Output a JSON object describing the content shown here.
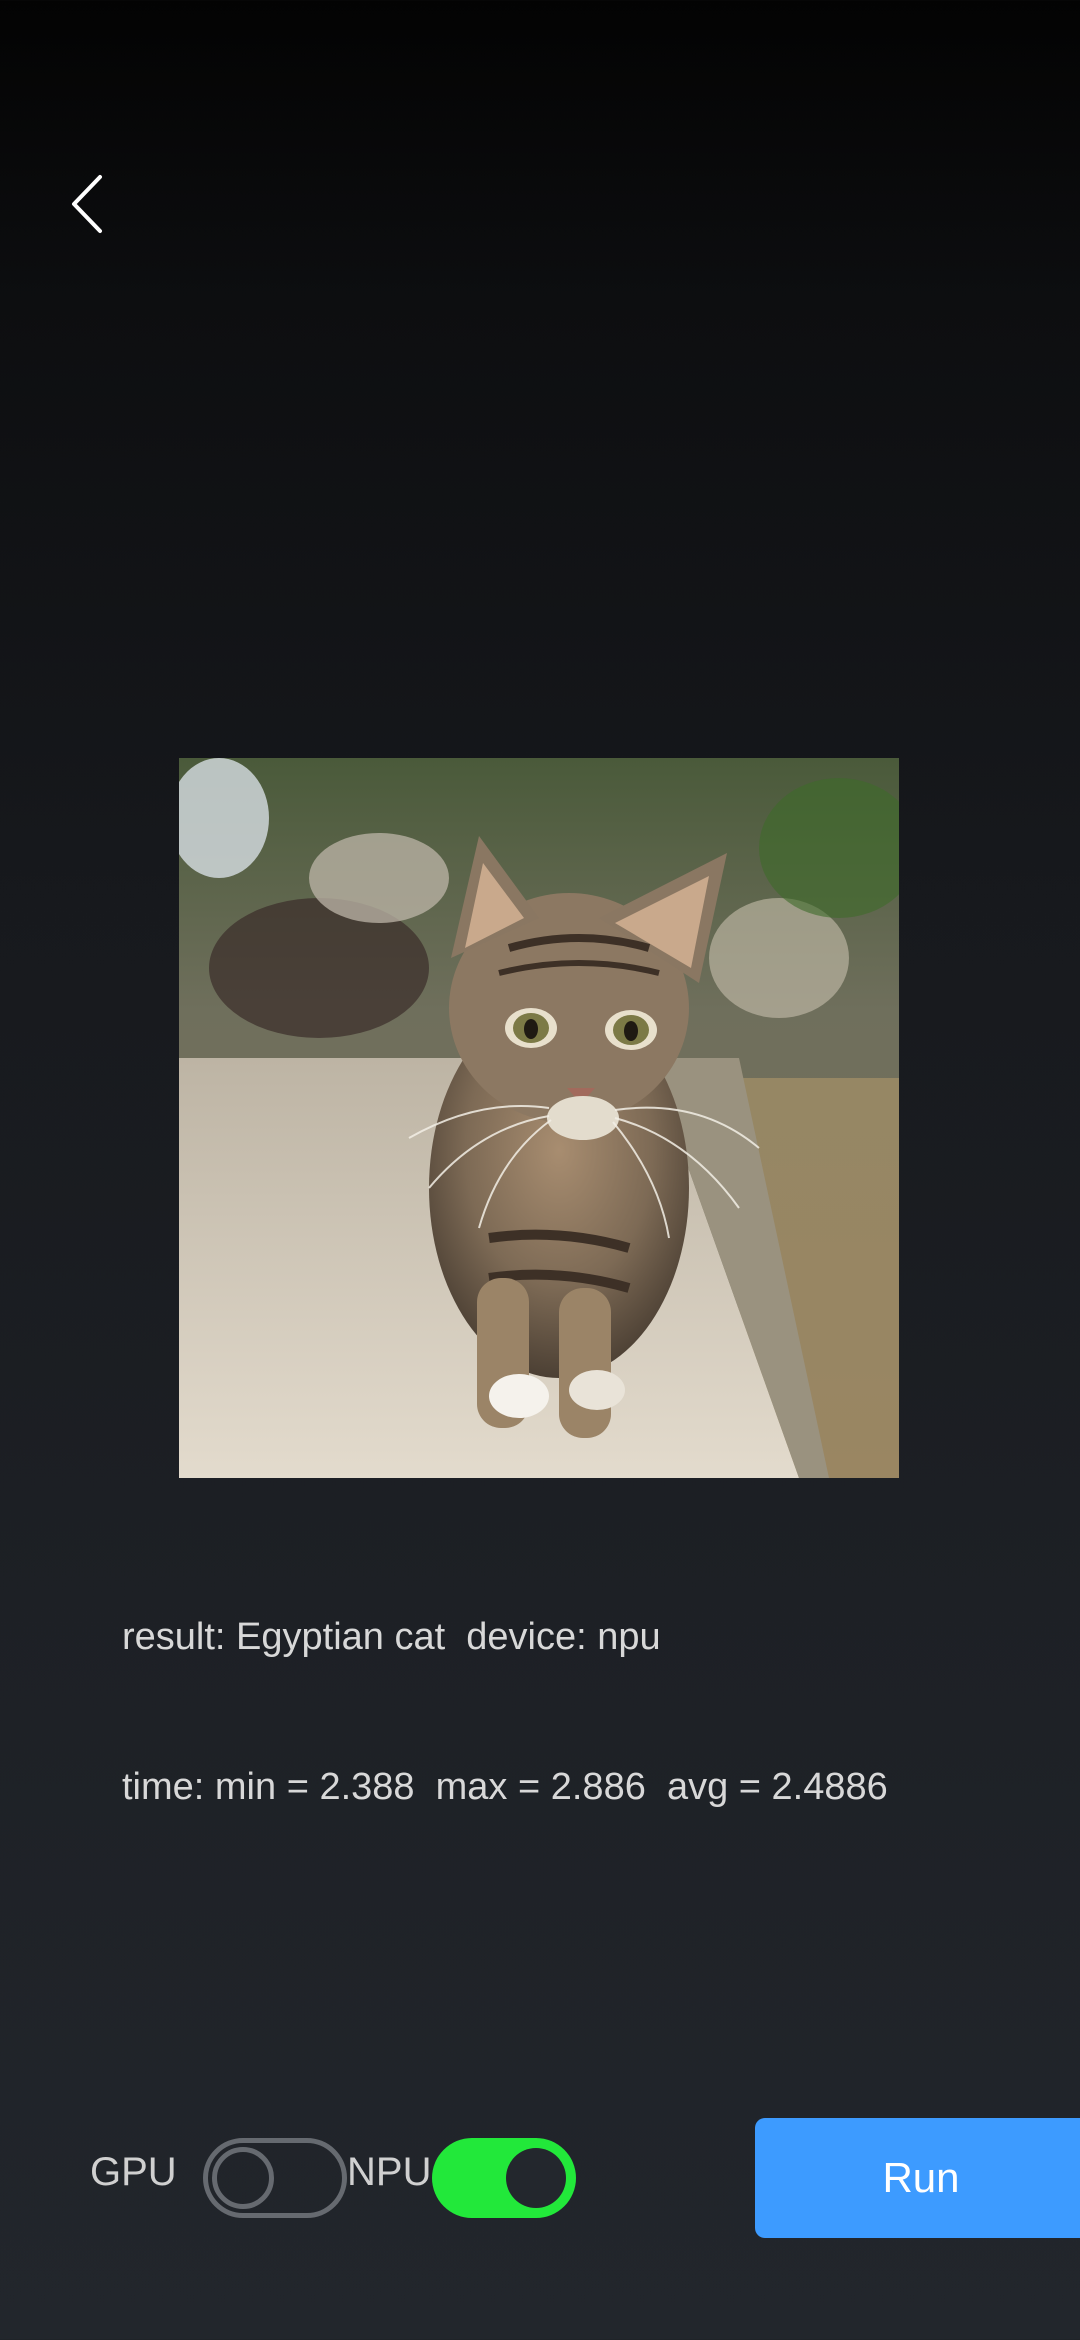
{
  "icons": {
    "back": "chevron-left-icon"
  },
  "image": {
    "subject": "tabby kitten walking on stone ledge"
  },
  "result": {
    "line1": "result: Egyptian cat  device: npu",
    "line2": "time: min = 2.388  max = 2.886  avg = 2.4886"
  },
  "controls": {
    "gpu_label": "GPU",
    "gpu_enabled": false,
    "npu_label": "NPU",
    "npu_enabled": true,
    "run_label": "Run"
  },
  "colors": {
    "accent": "#3d9bff",
    "toggle_on": "#22e83a",
    "toggle_off": "#666a70"
  }
}
